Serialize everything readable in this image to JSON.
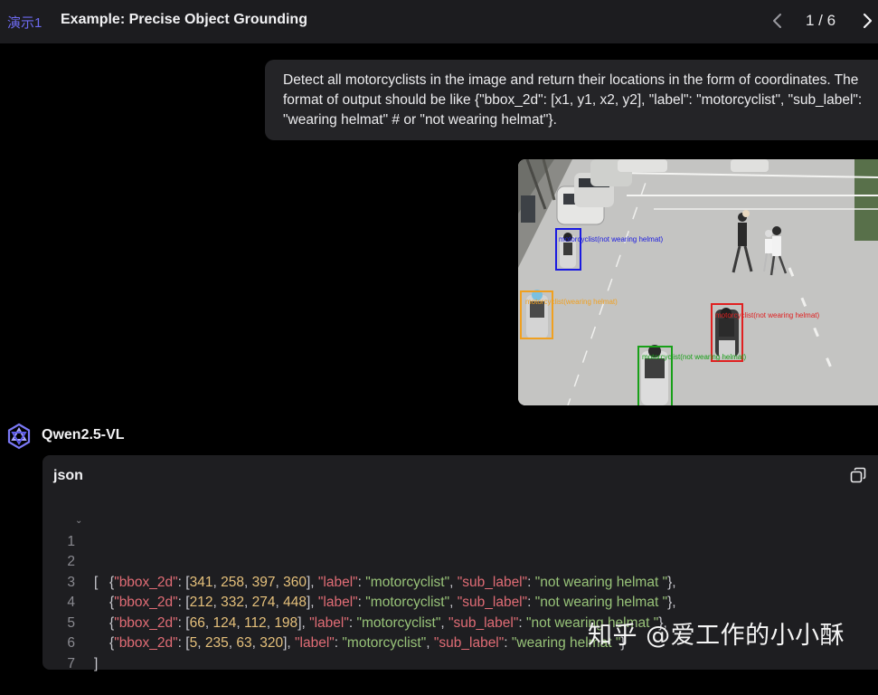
{
  "header": {
    "tag": "演示1",
    "title": "Example: Precise Object Grounding",
    "pager": "1 / 6",
    "prev_icon": "chevron-left-icon",
    "next_icon": "chevron-right-icon"
  },
  "user_message": {
    "text": "Detect all motorcyclists in the image and return their locations in the form of coordinates. The format of output should be like {\"bbox_2d\": [x1, y1, x2, y2], \"label\": \"motorcyclist\", \"sub_label\": \"wearing helmat\" # or \"not wearing helmat\"}."
  },
  "image": {
    "detections": [
      {
        "caption": "motorcyclist(not wearing helmat)",
        "color": "#1a1ae0"
      },
      {
        "caption": "motorcyclist(wearing helmat)",
        "color": "#f0a020"
      },
      {
        "caption": "motorcyclist(not wearing helmat)",
        "color": "#e02020"
      },
      {
        "caption": "motorcyclist(not wearing helmat)",
        "color": "#18a018"
      }
    ]
  },
  "assistant": {
    "name": "Qwen2.5-VL",
    "logo_icon": "qwen-logo-icon"
  },
  "code_block": {
    "language": "json",
    "copy_icon": "copy-icon",
    "line_numbers": [
      "1",
      "2",
      "3",
      "4",
      "5",
      "6",
      "7"
    ],
    "open_bracket": "[",
    "close_bracket": "]",
    "entries": [
      {
        "bbox": [
          "341",
          "258",
          "397",
          "360"
        ],
        "label": "motorcyclist",
        "sub_label": "not wearing helmat "
      },
      {
        "bbox": [
          "212",
          "332",
          "274",
          "448"
        ],
        "label": "motorcyclist",
        "sub_label": "not wearing helmat "
      },
      {
        "bbox": [
          "66",
          "124",
          "112",
          "198"
        ],
        "label": "motorcyclist",
        "sub_label": "not wearing helmat "
      },
      {
        "bbox": [
          "5",
          "235",
          "63",
          "320"
        ],
        "label": "motorcyclist",
        "sub_label": "wearing helmat "
      }
    ],
    "key_bbox": "\"bbox_2d\"",
    "key_label": "\"label\"",
    "key_sub_label": "\"sub_label\""
  },
  "watermark": "知乎 @爱工作的小小酥",
  "colors": {
    "background": "#000000",
    "header": "#1c1c1f",
    "bubble": "#242427",
    "code_card": "#1e1e21",
    "accent": "#6d6af0",
    "json_key": "#e06c75",
    "json_number": "#e5c07b",
    "json_string": "#98c379"
  }
}
